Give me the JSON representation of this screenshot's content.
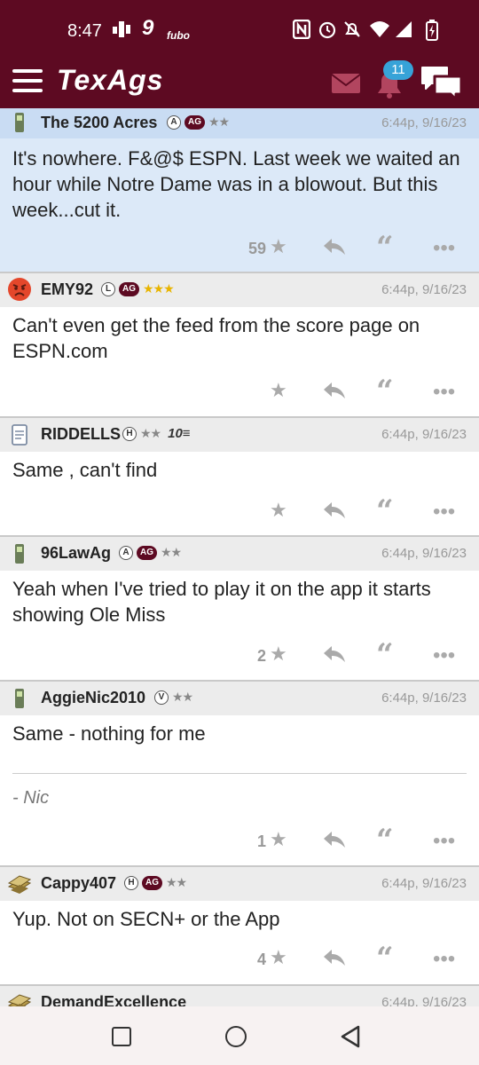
{
  "status_bar": {
    "time": "8:47",
    "icons": [
      "signal-app-icon",
      "channel-9-icon",
      "fubo-icon",
      "nfc-icon",
      "alarm-icon",
      "mute-icon",
      "wifi-icon",
      "cell-signal-icon",
      "battery-icon"
    ],
    "channel_label": "9",
    "fubo_label": "fubo"
  },
  "header": {
    "logo": "TexAgs",
    "notification_count": "11",
    "brand_color": "#5d0a22",
    "badge_color": "#37a3d8"
  },
  "posts": [
    {
      "username": "The 5200 Acres",
      "badges": [
        "A",
        "AG"
      ],
      "stars": "★★",
      "stars_color": "grey",
      "timestamp": "6:44p, 9/16/23",
      "body": "It's nowhere. F&@$ ESPN. Last week we waited an hour while Notre Dame was in a blowout. But this week...cut it.",
      "star_count": "59",
      "avatar": "phone-icon",
      "highlighted": true
    },
    {
      "username": "EMY92",
      "badges": [
        "L",
        "AG"
      ],
      "stars": "★★★",
      "stars_color": "gold",
      "timestamp": "6:44p, 9/16/23",
      "body": "Can't even get the feed from the score page on ESPN.com",
      "star_count": "",
      "avatar": "angry-face-icon"
    },
    {
      "username": "RIDDELLS",
      "badges": [
        "H"
      ],
      "stars": "★★",
      "stars_color": "grey",
      "extra_badge": "10",
      "timestamp": "6:44p, 9/16/23",
      "body": "Same , can't find",
      "star_count": "",
      "avatar": "notepad-icon"
    },
    {
      "username": "96LawAg",
      "badges": [
        "A",
        "AG"
      ],
      "stars": "★★",
      "stars_color": "grey",
      "timestamp": "6:44p, 9/16/23",
      "body": "Yeah when I've tried to play it on the app it starts showing Ole Miss",
      "star_count": "2",
      "avatar": "phone-icon"
    },
    {
      "username": "AggieNic2010",
      "badges": [
        "V"
      ],
      "stars": "★★",
      "stars_color": "grey",
      "timestamp": "6:44p, 9/16/23",
      "body": "Same - nothing for me",
      "signature": "- Nic",
      "star_count": "1",
      "avatar": "phone-icon"
    },
    {
      "username": "Cappy407",
      "badges": [
        "H",
        "AG"
      ],
      "stars": "★★",
      "stars_color": "grey",
      "timestamp": "6:44p, 9/16/23",
      "body": "Yup. Not on SECN+ or the App",
      "star_count": "4",
      "avatar": "money-stack-icon"
    },
    {
      "username": "DemandExcellence",
      "badges": [],
      "stars": "",
      "timestamp": "6:44p, 9/16/23",
      "body": "",
      "star_count": "",
      "avatar": "money-stack-icon"
    }
  ]
}
